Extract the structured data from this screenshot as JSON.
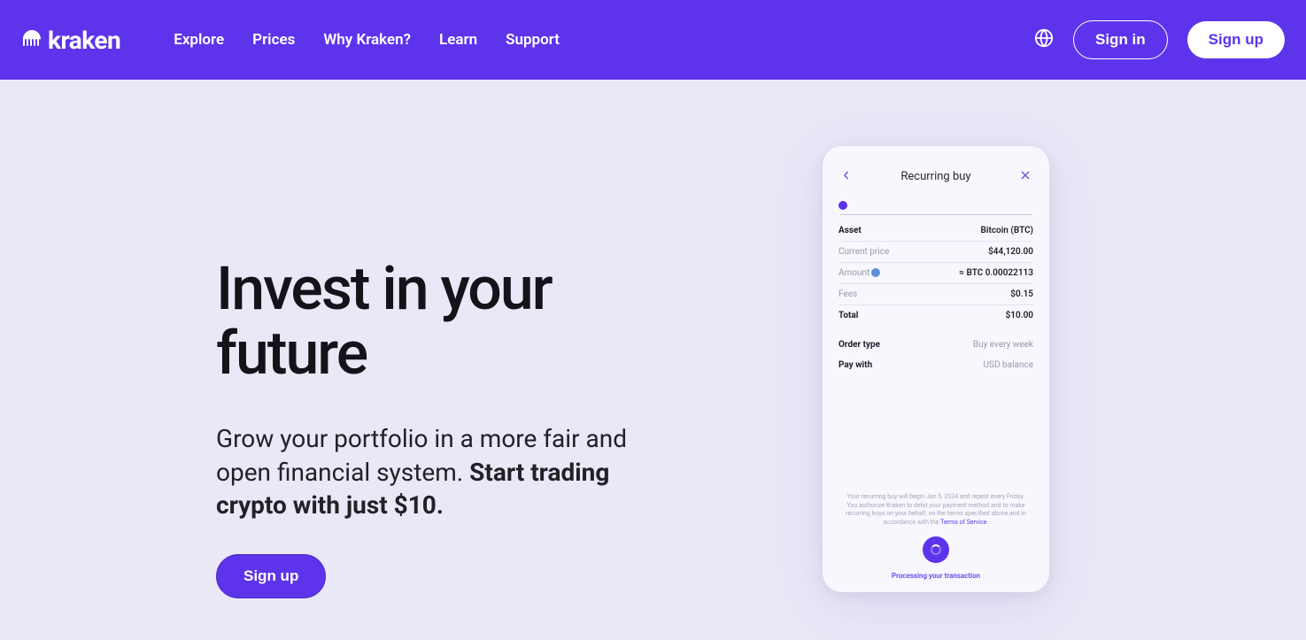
{
  "header": {
    "logo": "kraken",
    "nav": [
      "Explore",
      "Prices",
      "Why Kraken?",
      "Learn",
      "Support"
    ],
    "signin": "Sign in",
    "signup": "Sign up"
  },
  "hero": {
    "title": "Invest in your future",
    "sub_plain": "Grow your portfolio in a more fair and open financial system. ",
    "sub_bold": "Start trading crypto with just $10.",
    "cta": "Sign up"
  },
  "phone": {
    "title": "Recurring buy",
    "rows": {
      "asset": {
        "label": "Asset",
        "value": "Bitcoin (BTC)"
      },
      "price": {
        "label": "Current price",
        "value": "$44,120.00"
      },
      "amount": {
        "label": "Amount",
        "value": "≈ BTC 0.00022113"
      },
      "fees": {
        "label": "Fees",
        "value": "$0.15"
      },
      "total": {
        "label": "Total",
        "value": "$10.00"
      },
      "order_type": {
        "label": "Order type",
        "value": "Buy every week"
      },
      "pay_with": {
        "label": "Pay with",
        "value": "USD balance"
      }
    },
    "disclaimer1": "Your recurring buy will begin Jan 5, 2024 and repeat every Friday.",
    "disclaimer2a": "You authorize Kraken to debit your payment method and to make recurring buys on your behalf, on the terms specified above and in accordance with the ",
    "disclaimer2b": "Terms of Service",
    "processing": "Processing your transaction"
  }
}
